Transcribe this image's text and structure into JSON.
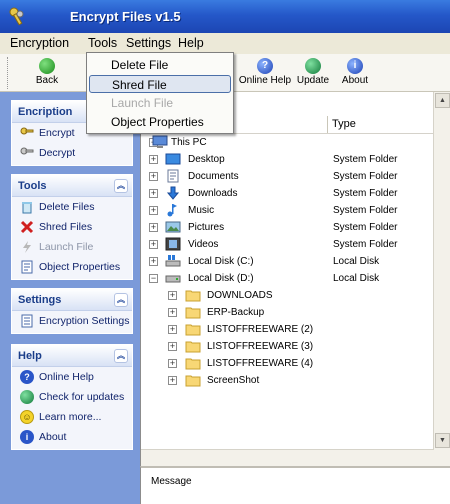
{
  "window": {
    "title": "Encrypt Files v1.5"
  },
  "menubar": [
    {
      "label": "Encryption"
    },
    {
      "label": "Tools"
    },
    {
      "label": "Settings"
    },
    {
      "label": "Help"
    }
  ],
  "toolbar": {
    "back": "Back",
    "online_help": "Online Help",
    "update": "Update",
    "about": "About"
  },
  "tools_menu": [
    {
      "label": "Delete File",
      "state": "normal"
    },
    {
      "label": "Shred File",
      "state": "selected"
    },
    {
      "label": "Launch File",
      "state": "disabled"
    },
    {
      "label": "Object Properties",
      "state": "normal"
    }
  ],
  "sidebar": {
    "encryption": {
      "title": "Encription",
      "items": [
        "Encrypt",
        "Decrypt"
      ]
    },
    "tools": {
      "title": "Tools",
      "items": [
        "Delete Files",
        "Shred Files",
        "Launch File",
        "Object Properties"
      ]
    },
    "settings": {
      "title": "Settings",
      "items": [
        "Encryption Settings"
      ]
    },
    "help": {
      "title": "Help",
      "items": [
        "Online Help",
        "Check for updates",
        "Learn more...",
        "About"
      ]
    }
  },
  "tree": {
    "columns": {
      "name": "",
      "type": "Type"
    },
    "root": "This PC",
    "items": [
      {
        "name": "Desktop",
        "type": "System Folder",
        "icon": "desktop-icon"
      },
      {
        "name": "Documents",
        "type": "System Folder",
        "icon": "documents-icon"
      },
      {
        "name": "Downloads",
        "type": "System Folder",
        "icon": "downloads-icon"
      },
      {
        "name": "Music",
        "type": "System Folder",
        "icon": "music-icon"
      },
      {
        "name": "Pictures",
        "type": "System Folder",
        "icon": "pictures-icon"
      },
      {
        "name": "Videos",
        "type": "System Folder",
        "icon": "videos-icon"
      },
      {
        "name": "Local Disk (C:)",
        "type": "Local Disk",
        "icon": "windows-drive-icon"
      },
      {
        "name": "Local Disk (D:)",
        "type": "Local Disk",
        "icon": "drive-icon"
      }
    ],
    "d_children": [
      "DOWNLOADS",
      "ERP-Backup",
      "LISTOFFREEWARE (2)",
      "LISTOFFREEWARE (3)",
      "LISTOFFREEWARE (4)",
      "ScreenShot"
    ]
  },
  "message_panel": {
    "header": "Message"
  }
}
